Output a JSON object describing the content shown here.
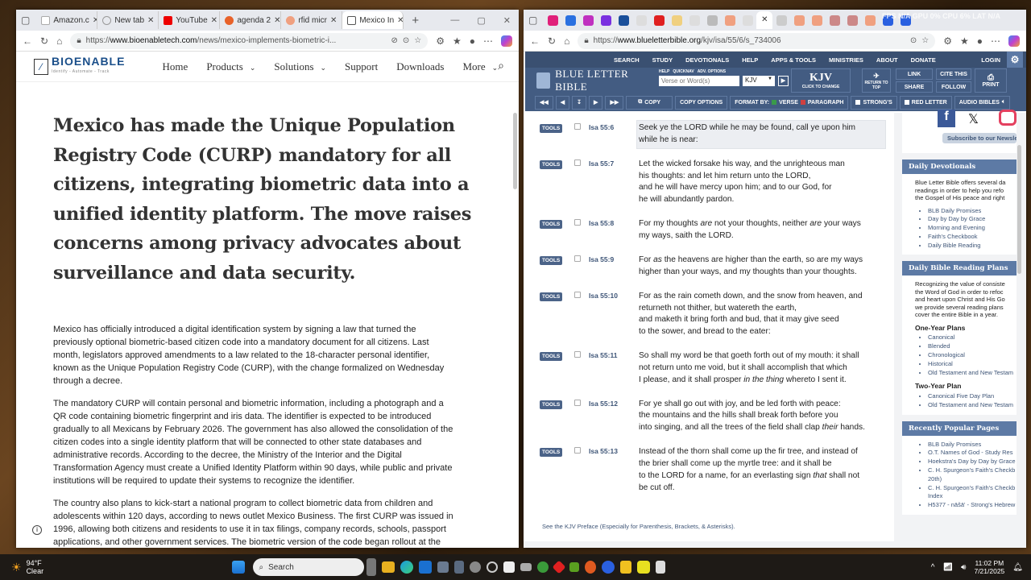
{
  "left_browser": {
    "tabs": [
      "Amazon.c",
      "New tab",
      "YouTube",
      "agenda 2",
      "rfid micr",
      "Mexico In"
    ],
    "url_prefix": "https://",
    "url_domain": "www.bioenabletech.com",
    "url_path": "/news/mexico-implements-biometric-i...",
    "site": {
      "logo": "BIOENABLE",
      "tagline": "Identify - Automate - Track",
      "nav": [
        "Home",
        "Products",
        "Solutions",
        "Support",
        "Downloads",
        "More"
      ]
    },
    "headline": "Mexico has made the Unique Population\nRegistry Code (CURP) mandatory for all\ncitizens, integrating biometric data into a\nunified identity platform. The move raises\nconcerns among privacy advocates about\nsurveillance and data security.",
    "paragraphs": [
      "Mexico has officially introduced a digital identification system by signing a law that turned the\npreviously optional biometric-based citizen code into a mandatory document for all citizens. Last\nmonth, legislators approved amendments to a law related to the 18-character personal identifier,\nknown as the Unique Population Registry Code (CURP), with the change formalized on Wednesday\nthrough a decree.",
      "The mandatory CURP will contain personal and biometric information, including a photograph and a\nQR code containing biometric fingerprint and iris data. The identifier is expected to be introduced\ngradually to all Mexicans by February 2026. The government has also allowed the consolidation of the\ncitizen codes into a single identity platform that will be connected to other state databases and\nadministrative records. According to the decree, the Ministry of the Interior and the Digital\nTransformation Agency must create a Unified Identity Platform within 90 days, while public and private\ninstitutions will be required to update their systems to recognize the identifier.",
      "The country also plans to kick-start a national program to collect biometric data from children and\nadolescents within 120 days, according to news outlet Mexico Business. The first CURP was issued in\n1996, allowing both citizens and residents to use it in tax filings, company records, schools, passport\napplications, and other government services. The biometric version of the code began rollout at the"
    ]
  },
  "right_browser": {
    "url_prefix": "https://",
    "url_domain": "www.blueletterbible.org",
    "url_path": "/kjv/isa/55/6/s_734006",
    "overlay": "FPS N/A GPU 0% CPU 6% LAT N/A",
    "top_nav": [
      "SEARCH",
      "STUDY",
      "DEVOTIONALS",
      "HELP",
      "APPS & TOOLS",
      "MINISTRIES",
      "ABOUT",
      "DONATE"
    ],
    "login": "LOGIN",
    "logo": "BLUE LETTER BIBLE",
    "search_links": "HELP   QUICKNAV   ADV. OPTIONS",
    "search_placeholder": "Verse or Word(s)",
    "version_select": "KJV",
    "version_big": "KJV",
    "version_hint": "CLICK TO CHANGE",
    "return_top": "RETURN TO TOP",
    "link": "LINK",
    "share": "SHARE",
    "cite": "CITE THIS",
    "follow": "FOLLOW",
    "print": "PRINT",
    "toolbar": {
      "copy": "COPY",
      "copy_options": "COPY OPTIONS",
      "format_by": "FORMAT BY:",
      "verse": "VERSE",
      "paragraph": "PARAGRAPH",
      "strongs": "STRONG'S",
      "red_letter": "RED LETTER",
      "audio": "AUDIO BIBLES"
    },
    "tools_label": "TOOLS",
    "verses": [
      {
        "ref": "Isa 55:6",
        "lines": [
          [
            {
              "t": "Seek ye the LORD while he may be found, call ye upon him"
            }
          ],
          [
            {
              "t": "while he is near:"
            }
          ]
        ]
      },
      {
        "ref": "Isa 55:7",
        "lines": [
          [
            {
              "t": "Let the wicked forsake his way, and the unrighteous man"
            }
          ],
          [
            {
              "t": "his thoughts: and let him return unto the LORD,"
            }
          ],
          [
            {
              "t": "and he will have mercy upon him; and to our God, for"
            }
          ],
          [
            {
              "t": "he will abundantly pardon."
            }
          ]
        ]
      },
      {
        "ref": "Isa 55:8",
        "lines": [
          [
            {
              "t": "For my thoughts "
            },
            {
              "t": "are",
              "i": true
            },
            {
              "t": " not your thoughts, neither "
            },
            {
              "t": "are",
              "i": true
            },
            {
              "t": " your ways"
            }
          ],
          [
            {
              "t": "my ways, saith the LORD."
            }
          ]
        ]
      },
      {
        "ref": "Isa 55:9",
        "lines": [
          [
            {
              "t": "For "
            },
            {
              "t": "as",
              "i": true
            },
            {
              "t": " the heavens are higher than the earth, so are my ways"
            }
          ],
          [
            {
              "t": "higher than your ways, and my thoughts than your thoughts."
            }
          ]
        ]
      },
      {
        "ref": "Isa 55:10",
        "lines": [
          [
            {
              "t": "For as the rain cometh down, and the snow from heaven, and"
            }
          ],
          [
            {
              "t": "returneth not thither, but watereth the earth,"
            }
          ],
          [
            {
              "t": "and maketh it bring forth and bud, that it may give seed"
            }
          ],
          [
            {
              "t": "to the sower, and bread to the eater:"
            }
          ]
        ]
      },
      {
        "ref": "Isa 55:11",
        "lines": [
          [
            {
              "t": "So shall my word be that goeth forth out of my mouth: it shall"
            }
          ],
          [
            {
              "t": "not return unto me void, but it shall accomplish that which"
            }
          ],
          [
            {
              "t": "I please, and it shall prosper "
            },
            {
              "t": "in the thing",
              "i": true
            },
            {
              "t": " whereto I sent it."
            }
          ]
        ]
      },
      {
        "ref": "Isa 55:12",
        "lines": [
          [
            {
              "t": "For ye shall go out with joy, and be led forth with peace:"
            }
          ],
          [
            {
              "t": "the mountains and the hills shall break forth before you"
            }
          ],
          [
            {
              "t": "into singing, and all the trees of the field shall clap "
            },
            {
              "t": "their",
              "i": true
            },
            {
              "t": " hands."
            }
          ]
        ]
      },
      {
        "ref": "Isa 55:13",
        "lines": [
          [
            {
              "t": "Instead of the thorn shall come up the fir tree, and instead of"
            }
          ],
          [
            {
              "t": "the brier shall come up the myrtle tree: and it shall be"
            }
          ],
          [
            {
              "t": "to the LORD for a name, for an everlasting sign "
            },
            {
              "t": "that",
              "i": true
            },
            {
              "t": " shall not"
            }
          ],
          [
            {
              "t": "be cut off."
            }
          ]
        ]
      }
    ],
    "preface": "See the KJV Preface (Especially for Parenthesis, Brackets, & Asterisks).",
    "sidebar": {
      "subscribe": "Subscribe to our Newsletter",
      "devotionals": {
        "title": "Daily Devotionals",
        "text": "Blue Letter Bible offers several da\nreadings in order to help you refo\nthe Gospel of His peace and right",
        "items": [
          "BLB Daily Promises",
          "Day by Day by Grace",
          "Morning and Evening",
          "Faith's Checkbook",
          "Daily Bible Reading"
        ]
      },
      "plans": {
        "title": "Daily Bible Reading Plans",
        "text": "Recognizing the value of consiste\nthe Word of God in order to refoc\nand heart upon Christ and His Go\nwe provide several reading plans\ncover the entire Bible in a year.",
        "one_year": "One-Year Plans",
        "one_items": [
          "Canonical",
          "Blended",
          "Chronological",
          "Historical",
          "Old Testament and New Testam"
        ],
        "two_year": "Two-Year Plan",
        "two_items": [
          "Canonical Five Day Plan",
          "Old Testament and New Testam"
        ]
      },
      "popular": {
        "title": "Recently Popular Pages",
        "items": [
          "BLB Daily Promises",
          "O.T. Names of God - Study Res",
          "Hoekstra's Day by Day by Grace",
          "C. H. Spurgeon's Faith's Checkb 20th)",
          "C. H. Spurgeon's Faith's Checkb Index",
          "H5377 - nāšā' - Strong's Hebrew"
        ]
      }
    }
  },
  "taskbar": {
    "temp": "94°F",
    "weather": "Clear",
    "search": "Search",
    "time": "11:02 PM",
    "date": "7/21/2025"
  }
}
